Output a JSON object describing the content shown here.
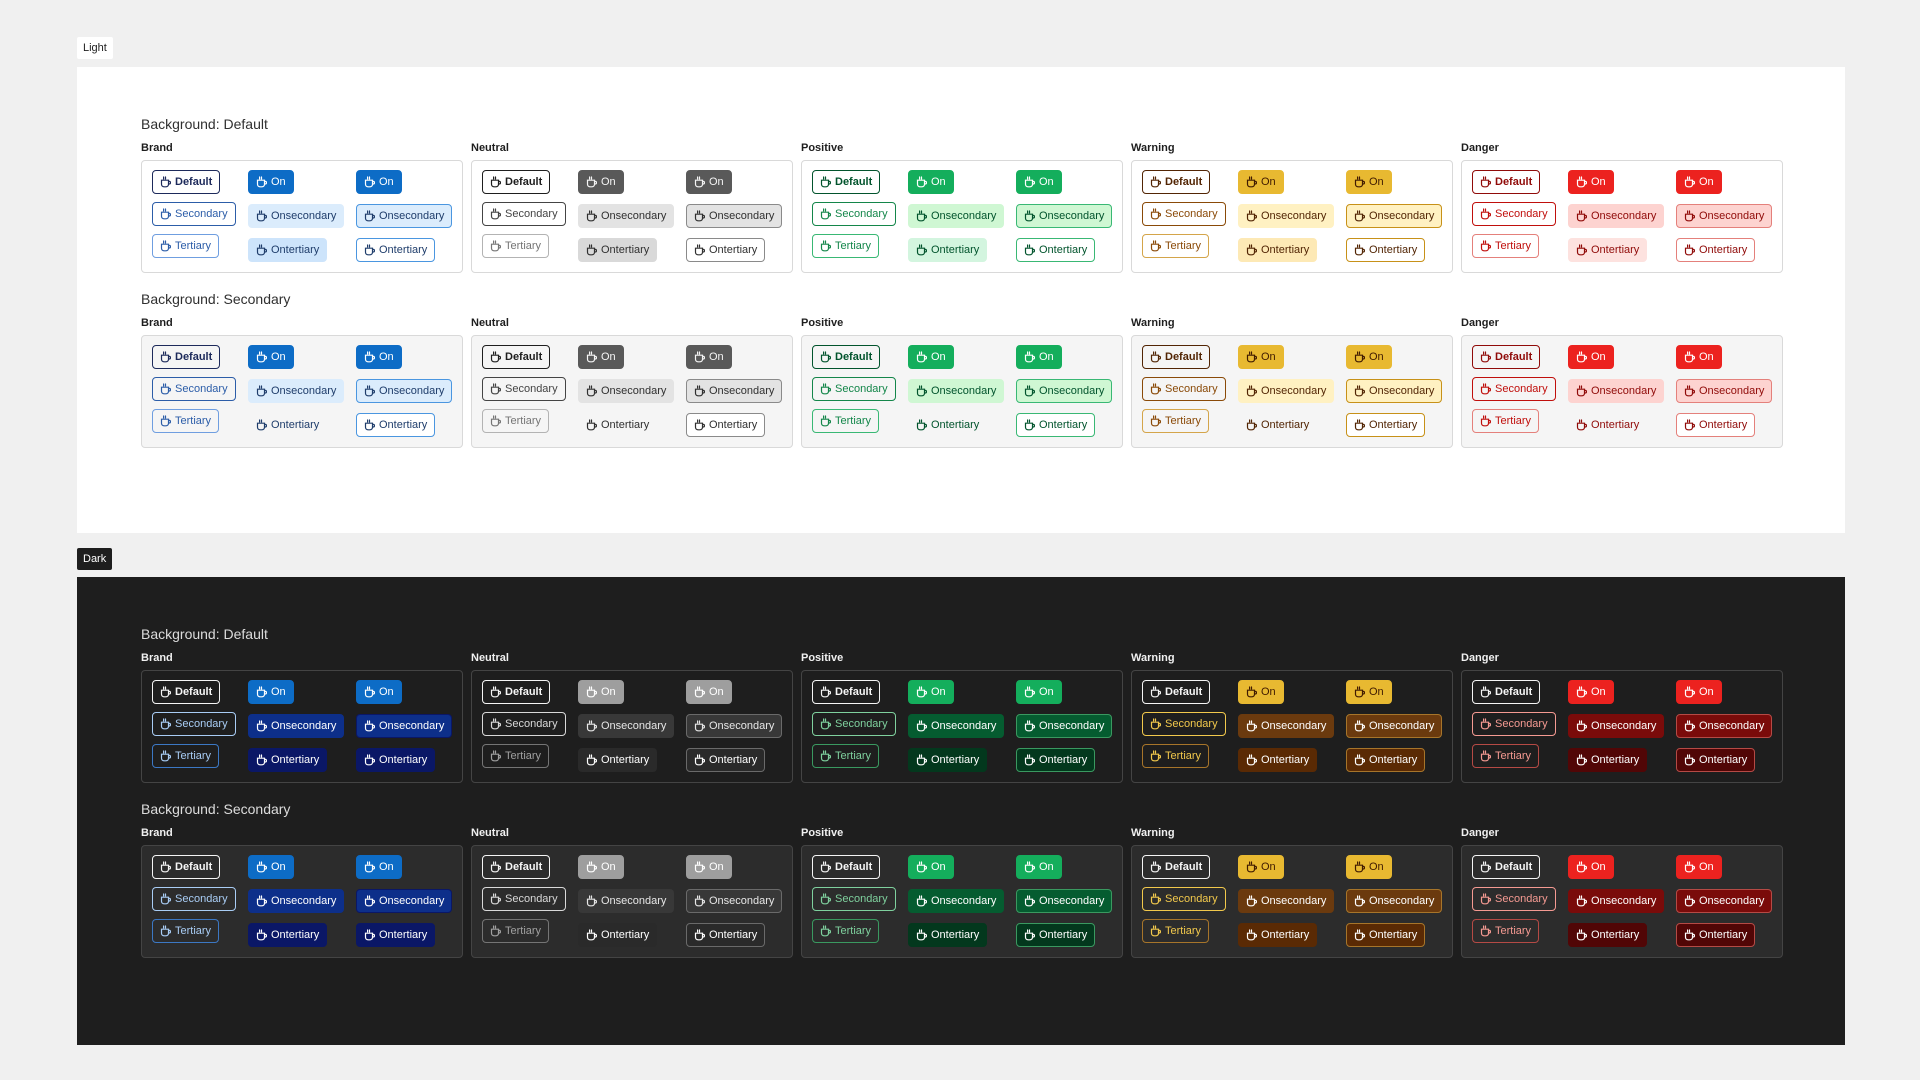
{
  "labels": {
    "light": "Light",
    "dark": "Dark"
  },
  "sections": {
    "default": {
      "title": "Background: Default"
    },
    "secondary": {
      "title": "Background: Secondary"
    }
  },
  "groups": [
    "Brand",
    "Neutral",
    "Positive",
    "Warning",
    "Danger"
  ],
  "buttons": {
    "default": "Default",
    "secondary": "Secondary",
    "tertiary": "Tertiary",
    "on": "On",
    "onsecondary": "Onsecondary",
    "ontertiary": "Ontertiary"
  },
  "icon": "coffee-cup-icon",
  "palette": {
    "light": {
      "bg_default": "#ffffff",
      "bg_secondary": "#f5f5f5",
      "group_border": "#d9d9d9",
      "Brand": {
        "strong": "#1d2a5b",
        "accent": "#2c5da8",
        "accent_border": "#6f9ee0",
        "fill": "#0d6cc6",
        "on_text": "#ffffff",
        "soft": "#dbecfc",
        "soft_text": "#1f3d6b",
        "med": "#cde4fb",
        "med_border": "#4a96e0"
      },
      "Neutral": {
        "strong": "#1e1e1e",
        "accent": "#444444",
        "accent_border": "#8a8a8a",
        "tertiary": "#b3b3b3",
        "tertiary_text": "#757575",
        "fill": "#595959",
        "on_text": "#f5f5f5",
        "soft": "#e3e3e3",
        "soft_text": "#303030",
        "med": "#d9d9d9",
        "med_border": "#8a8a8a"
      },
      "Positive": {
        "strong": "#02542d",
        "accent": "#14864a",
        "accent_border": "#39b874",
        "fill": "#14ae5c",
        "on_text": "#ffffff",
        "soft": "#cff7d3",
        "soft_text": "#02542d",
        "med": "#d3f5df",
        "med_border": "#39b874"
      },
      "Warning": {
        "strong": "#522504",
        "accent": "#8a4a08",
        "accent_border": "#d4a54a",
        "fill": "#e8b931",
        "on_text": "#401b01",
        "soft": "#fff1c2",
        "soft_text": "#522504",
        "med": "#fde9b5",
        "med_border": "#c79118"
      },
      "Danger": {
        "strong": "#900b09",
        "accent": "#c00f0c",
        "accent_border": "#e4807b",
        "fill": "#ec221f",
        "on_text": "#ffffff",
        "soft": "#fdd3d0",
        "soft_text": "#900b09",
        "med": "#fde2df",
        "med_border": "#e4807b"
      }
    },
    "dark": {
      "bg_default": "#1e1e1e",
      "bg_secondary": "#2c2c2c",
      "group_border": "#444444",
      "Brand": {
        "strong": "#f5f5f5",
        "accent": "#a9cdf5",
        "accent_border": "#3c78c4",
        "fill": "#0d6cc6",
        "on_text": "#ffffff",
        "soft": "#0d2f8a",
        "soft_text": "#ffffff",
        "med": "#0a1766",
        "med_border": "#0a1766"
      },
      "Neutral": {
        "strong": "#f5f5f5",
        "accent": "#d9d9d9",
        "accent_border": "#757575",
        "tertiary": "#757575",
        "tertiary_text": "#a0a0a0",
        "fill": "#9e9e9e",
        "on_text": "#ffffff",
        "soft": "#383838",
        "soft_text": "#e6e6e6",
        "med": "#2a2a2a",
        "med_border": "#6a6a6a"
      },
      "Positive": {
        "strong": "#f5f5f5",
        "accent": "#7fd19e",
        "accent_border": "#3a9960",
        "fill": "#14ae5c",
        "on_text": "#ffffff",
        "soft": "#055c30",
        "soft_text": "#ffffff",
        "med": "#03381d",
        "med_border": "#3a9960"
      },
      "Warning": {
        "strong": "#f5f5f5",
        "accent": "#f2c94c",
        "accent_border": "#a7752a",
        "fill": "#e8b931",
        "on_text": "#401b01",
        "soft": "#6b3a0e",
        "soft_text": "#ffffff",
        "med": "#5a2a04",
        "med_border": "#a7752a"
      },
      "Danger": {
        "strong": "#f5f5f5",
        "accent": "#f59a92",
        "accent_border": "#b54a45",
        "fill": "#ec221f",
        "on_text": "#ffffff",
        "soft": "#7a0b0a",
        "soft_text": "#ffffff",
        "med": "#510606",
        "med_border": "#b54a45"
      }
    }
  }
}
